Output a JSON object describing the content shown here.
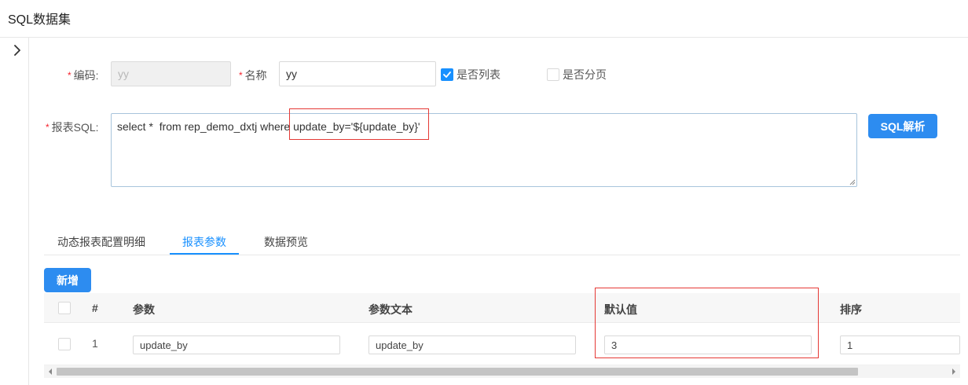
{
  "header": {
    "title": "SQL数据集"
  },
  "icons": {
    "expand": "chevron-right-icon",
    "check": "check-icon",
    "scroll_left": "caret-left-icon",
    "scroll_right": "caret-right-icon"
  },
  "colors": {
    "primary": "#2d8cf0",
    "active_tab": "#1890ff",
    "required": "#f5222d",
    "annotation_box": "#e53935"
  },
  "form": {
    "required_mark": "*",
    "code_label": "编码:",
    "code_value": "yy",
    "name_label": "名称",
    "name_value": "yy",
    "is_list_label": "是否列表",
    "is_list_checked": true,
    "is_paged_label": "是否分页",
    "is_paged_checked": false,
    "sql_label": "报表SQL:",
    "sql_value": "select *  from rep_demo_dxtj where update_by='${update_by}'",
    "parse_button": "SQL解析"
  },
  "tabs": [
    {
      "label": "动态报表配置明细",
      "active": false
    },
    {
      "label": "报表参数",
      "active": true
    },
    {
      "label": "数据预览",
      "active": false
    }
  ],
  "toolbar": {
    "add_button": "新增"
  },
  "table": {
    "headers": {
      "index": "#",
      "param": "参数",
      "param_text": "参数文本",
      "default_value": "默认值",
      "order": "排序"
    },
    "rows": [
      {
        "index": "1",
        "param": "update_by",
        "param_text": "update_by",
        "default_value": "3",
        "order": "1"
      }
    ]
  }
}
